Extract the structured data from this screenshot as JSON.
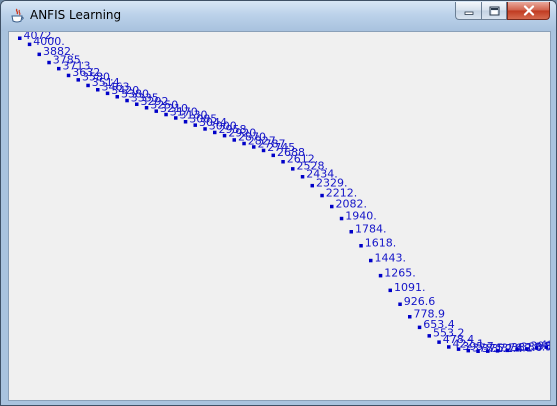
{
  "window": {
    "title": "ANFIS Learning",
    "app_icon": "java-cup-icon",
    "controls": [
      "minimize-icon",
      "maximize-icon",
      "close-icon"
    ]
  },
  "colors": {
    "points": "#0000c8",
    "labels": "#1515c8",
    "background": "#f0f0f0"
  },
  "chart_data": {
    "type": "scatter",
    "title": "",
    "xlabel": "",
    "ylabel": "",
    "grid": false,
    "axes_visible": false,
    "xlim": [
      0,
      55
    ],
    "ylim": [
      0,
      4200
    ],
    "x": [
      0,
      1,
      2,
      3,
      4,
      5,
      6,
      7,
      8,
      9,
      10,
      11,
      12,
      13,
      14,
      15,
      16,
      17,
      18,
      19,
      20,
      21,
      22,
      23,
      24,
      25,
      26,
      27,
      28,
      29,
      30,
      31,
      32,
      33,
      34,
      35,
      36,
      37,
      38,
      39,
      40,
      41,
      42,
      43,
      44,
      45,
      46,
      47,
      48,
      49,
      50,
      51,
      52,
      53,
      54
    ],
    "values": [
      4072,
      4000,
      3882,
      3785,
      3713,
      3632,
      3580,
      3514,
      3463,
      3420,
      3380,
      3335,
      3292,
      3250,
      3210,
      3170,
      3130,
      3085,
      3044,
      3000,
      2958,
      2920,
      2870,
      2827,
      2787,
      2745,
      2688,
      2612,
      2528,
      2434,
      2329,
      2212,
      2082,
      1940,
      1784,
      1618,
      1443,
      1265,
      1091,
      926.6,
      778.9,
      653.4,
      553.2,
      478.4,
      422.1,
      395.7,
      378.5,
      371.1,
      372.4,
      376.1,
      382.0,
      388.5,
      398.4,
      410.2,
      420.0
    ],
    "labels": [
      "4072.",
      "4000.",
      "3882.",
      "3785.",
      "3713.",
      "3632.",
      "3580.",
      "3514.",
      "3463.",
      "3420.",
      "3380.",
      "3335.",
      "3292.",
      "3250.",
      "3210.",
      "3170.",
      "3130.",
      "3085.",
      "3044.",
      "3000.",
      "2958.",
      "2920.",
      "2870.",
      "2827.",
      "2787.",
      "2745.",
      "2688.",
      "2612.",
      "2528.",
      "2434.",
      "2329.",
      "2212.",
      "2082.",
      "1940.",
      "1784.",
      "1618.",
      "1443.",
      "1265.",
      "1091.",
      "926.6",
      "778.9",
      "653.4",
      "553.2",
      "478.4",
      "422.1",
      "395.7",
      "378.5",
      "371.1",
      "372.4",
      "376.1",
      "382.0",
      "388.5",
      "398.4",
      "410.2",
      "420.0"
    ]
  }
}
